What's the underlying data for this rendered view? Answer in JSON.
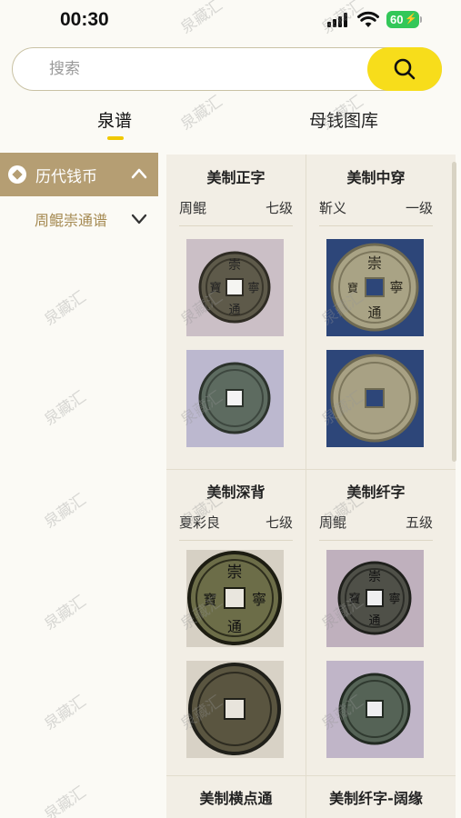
{
  "status_bar": {
    "time": "00:30",
    "battery": "60"
  },
  "search": {
    "placeholder": "搜索"
  },
  "tabs": [
    {
      "label": "泉谱",
      "active": true
    },
    {
      "label": "母钱图库",
      "active": false
    }
  ],
  "sidebar": {
    "category": {
      "label": "历代钱币",
      "expanded": true
    },
    "subcategory": {
      "label": "周鲲崇通谱",
      "expanded": false
    }
  },
  "cards": [
    {
      "name": "美制正字",
      "owner": "周鲲",
      "grade": "七级"
    },
    {
      "name": "美制中穿",
      "owner": "靳义",
      "grade": "一级"
    },
    {
      "name": "美制深背",
      "owner": "夏彩良",
      "grade": "七级"
    },
    {
      "name": "美制纤字",
      "owner": "周鲲",
      "grade": "五级"
    },
    {
      "name": "美制横点通",
      "owner": "",
      "grade": ""
    },
    {
      "name": "美制纤字-阔缘",
      "owner": "",
      "grade": ""
    }
  ],
  "coin_text": {
    "top": "崇",
    "right": "寧",
    "bottom": "通",
    "left": "寶"
  },
  "watermark": "泉藏汇",
  "colors": {
    "accent_yellow": "#f7dd1b",
    "sidebar_active": "#b59e73",
    "sub_text": "#a58a52"
  }
}
